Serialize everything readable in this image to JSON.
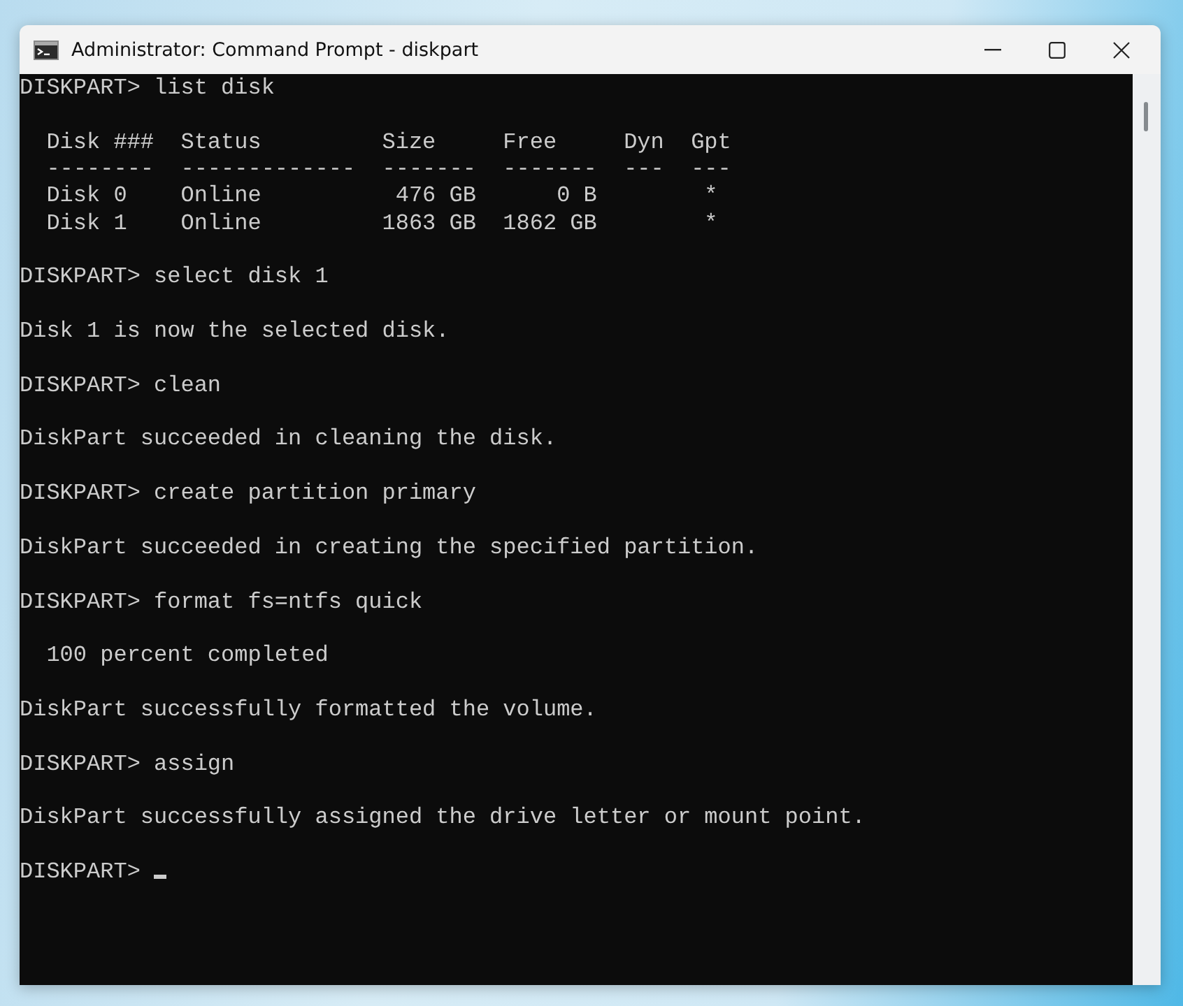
{
  "window": {
    "title": "Administrator: Command Prompt - diskpart"
  },
  "console": {
    "lines": [
      {
        "kind": "prompt",
        "prompt": "DISKPART>",
        "command": "list disk"
      },
      {
        "kind": "blank"
      },
      {
        "kind": "output",
        "text": "  Disk ###  Status         Size     Free     Dyn  Gpt"
      },
      {
        "kind": "output",
        "text": "  --------  -------------  -------  -------  ---  ---"
      },
      {
        "kind": "output",
        "text": "  Disk 0    Online          476 GB      0 B        *"
      },
      {
        "kind": "output",
        "text": "  Disk 1    Online         1863 GB  1862 GB        *"
      },
      {
        "kind": "blank"
      },
      {
        "kind": "prompt",
        "prompt": "DISKPART>",
        "command": "select disk 1"
      },
      {
        "kind": "blank"
      },
      {
        "kind": "output",
        "text": "Disk 1 is now the selected disk."
      },
      {
        "kind": "blank"
      },
      {
        "kind": "prompt",
        "prompt": "DISKPART>",
        "command": "clean"
      },
      {
        "kind": "blank"
      },
      {
        "kind": "output",
        "text": "DiskPart succeeded in cleaning the disk."
      },
      {
        "kind": "blank"
      },
      {
        "kind": "prompt",
        "prompt": "DISKPART>",
        "command": "create partition primary"
      },
      {
        "kind": "blank"
      },
      {
        "kind": "output",
        "text": "DiskPart succeeded in creating the specified partition."
      },
      {
        "kind": "blank"
      },
      {
        "kind": "prompt",
        "prompt": "DISKPART>",
        "command": "format fs=ntfs quick"
      },
      {
        "kind": "blank"
      },
      {
        "kind": "output",
        "text": "  100 percent completed"
      },
      {
        "kind": "blank"
      },
      {
        "kind": "output",
        "text": "DiskPart successfully formatted the volume."
      },
      {
        "kind": "blank"
      },
      {
        "kind": "prompt",
        "prompt": "DISKPART>",
        "command": "assign"
      },
      {
        "kind": "blank"
      },
      {
        "kind": "output",
        "text": "DiskPart successfully assigned the drive letter or mount point."
      },
      {
        "kind": "blank"
      },
      {
        "kind": "prompt",
        "prompt": "DISKPART>",
        "cursor": true
      }
    ]
  }
}
